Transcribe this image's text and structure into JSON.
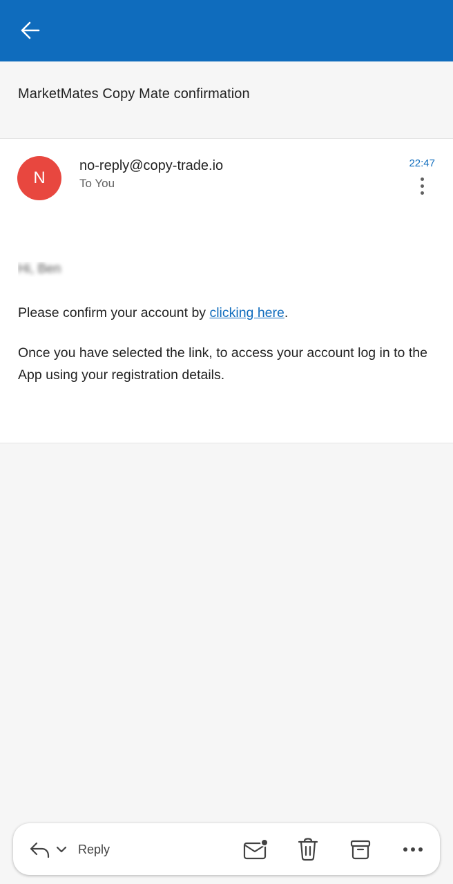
{
  "header": {
    "back_icon": "arrow-left-icon",
    "bar_color": "#0f6cbd"
  },
  "email": {
    "subject": "MarketMates Copy Mate confirmation",
    "sender_initial": "N",
    "sender": "no-reply@copy-trade.io",
    "recipient": "To You",
    "time": "22:47",
    "avatar_color": "#e8473f",
    "greeting": "Hi, Ben",
    "p1_prefix": "Please confirm your account by ",
    "p1_link": "clicking here",
    "p1_suffix": ".",
    "p2": "Once you have selected the link, to access your account log in to the App using your registration details."
  },
  "actions": {
    "reply_label": "Reply",
    "icons": [
      "reply-icon",
      "chevron-down-icon",
      "mark-unread-icon",
      "delete-icon",
      "archive-icon",
      "more-horizontal-icon"
    ]
  }
}
